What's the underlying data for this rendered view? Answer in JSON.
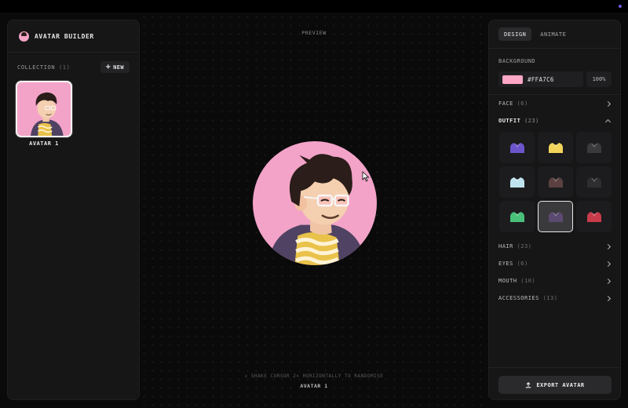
{
  "app": {
    "title": "AVATAR BUILDER"
  },
  "sidebar": {
    "collection_label": "COLLECTION",
    "collection_count": "(1)",
    "new_button": "NEW",
    "avatars": [
      {
        "label": "AVATAR 1"
      }
    ]
  },
  "preview": {
    "label": "PREVIEW",
    "hint": "↕ SHAKE CURSOR 2× HORIZONTALLY TO RANDOMISE",
    "name": "AVATAR 1"
  },
  "panel": {
    "tabs": [
      {
        "label": "DESIGN",
        "active": true
      },
      {
        "label": "ANIMATE",
        "active": false
      }
    ],
    "background": {
      "label": "BACKGROUND",
      "hex": "#FFA7C6",
      "opacity": "100%",
      "color": "#ffa7c6"
    },
    "sections": [
      {
        "name": "FACE",
        "count": "(6)",
        "open": false
      },
      {
        "name": "OUTFIT",
        "count": "(23)",
        "open": true
      },
      {
        "name": "HAIR",
        "count": "(23)",
        "open": false
      },
      {
        "name": "EYES",
        "count": "(6)",
        "open": false
      },
      {
        "name": "MOUTH",
        "count": "(10)",
        "open": false
      },
      {
        "name": "ACCESSORIES",
        "count": "(13)",
        "open": false
      }
    ],
    "outfit_options": [
      {
        "name": "outfit-purple-hoodie",
        "color": "#6b55c9",
        "selected": false
      },
      {
        "name": "outfit-yellow-tee",
        "color": "#f2d45a",
        "selected": false
      },
      {
        "name": "outfit-dark-blazer",
        "color": "#3a3a3c",
        "selected": false
      },
      {
        "name": "outfit-light-blue-shirt",
        "color": "#bfe3ee",
        "selected": false
      },
      {
        "name": "outfit-brown-jacket",
        "color": "#5a4040",
        "selected": false
      },
      {
        "name": "outfit-black-suit",
        "color": "#2e2e30",
        "selected": false
      },
      {
        "name": "outfit-green-tee",
        "color": "#49c07a",
        "selected": false
      },
      {
        "name": "outfit-purple-jacket-striped",
        "color": "#5b4a70",
        "selected": true
      },
      {
        "name": "outfit-red-dotted",
        "color": "#c93b4b",
        "selected": false
      }
    ],
    "export_button": "EXPORT AVATAR"
  }
}
